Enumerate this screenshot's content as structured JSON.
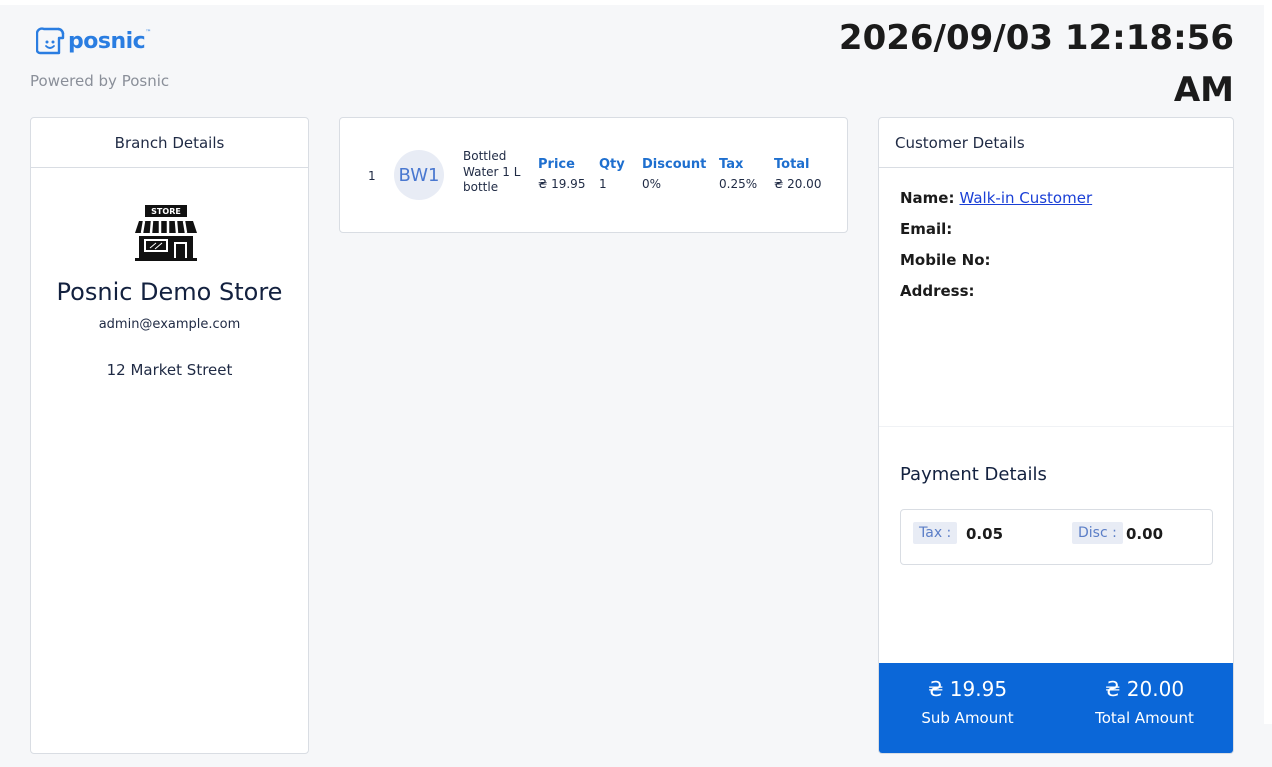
{
  "header": {
    "logo_text": "posnic",
    "logo_tm": "™",
    "powered_by": "Powered by Posnic",
    "datetime": "2026/09/03 12:18:56 AM"
  },
  "branch": {
    "heading": "Branch Details",
    "store_sign": "STORE",
    "store_name": "Posnic Demo Store",
    "email": "admin@example.com",
    "address": "12 Market Street"
  },
  "items": [
    {
      "index": "1",
      "avatar": "BW1",
      "name": "Bottled Water 1 L bottle",
      "price": "₴ 19.95",
      "qty": "1",
      "discount": "0%",
      "tax": "0.25%",
      "total": "₴ 20.00"
    }
  ],
  "item_columns": {
    "price": "Price",
    "qty": "Qty",
    "discount": "Discount",
    "tax": "Tax",
    "total": "Total"
  },
  "customer": {
    "heading": "Customer Details",
    "name_label": "Name:",
    "name_value": "Walk-in Customer",
    "email_label": "Email:",
    "mobile_label": "Mobile No:",
    "address_label": "Address:"
  },
  "payment": {
    "heading": "Payment Details",
    "tax_label": "Tax :",
    "tax_value": "0.05",
    "disc_label": "Disc :",
    "disc_value": "0.00"
  },
  "totals": {
    "sub_amount": "₴ 19.95",
    "sub_label": "Sub Amount",
    "total_amount": "₴ 20.00",
    "total_label": "Total Amount"
  },
  "colors": {
    "accent": "#0b67d8",
    "column_header": "#1e6fcf",
    "link": "#1a3fd6"
  },
  "icons": {
    "logo": "posnic-logo-icon",
    "store": "storefront-icon"
  }
}
